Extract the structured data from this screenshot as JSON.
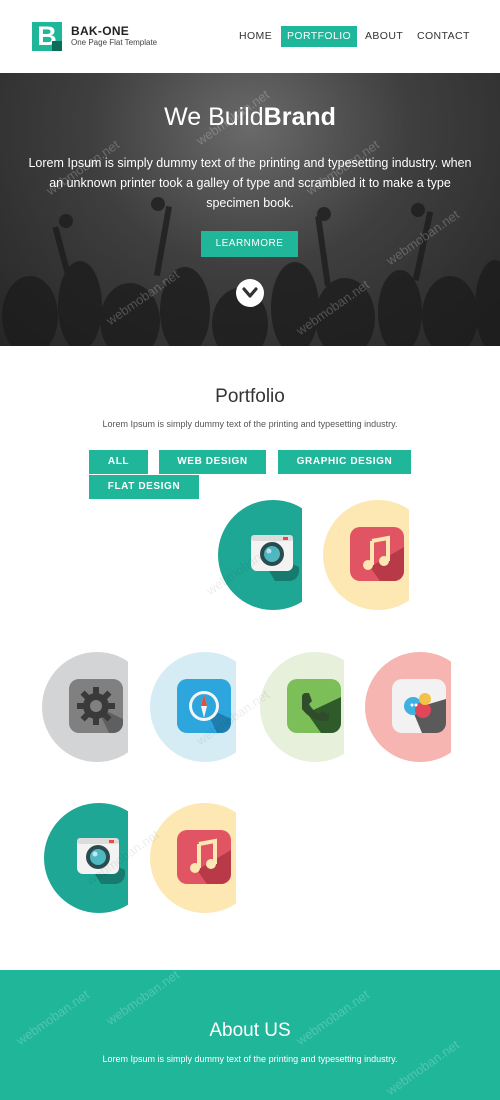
{
  "brand": {
    "name": "BAK-ONE",
    "tagline": "One Page Flat Template",
    "logo_letter": "B",
    "accent": "#1fb69a"
  },
  "nav": {
    "items": [
      "HOME",
      "PORTFOLIO",
      "ABOUT",
      "CONTACT"
    ],
    "active": "PORTFOLIO"
  },
  "hero": {
    "title_light": "We Build",
    "title_bold": "Brand",
    "text": "Lorem Ipsum is simply dummy text of the printing and typesetting industry. when an unknown printer took a galley of type and scrambled it to make a type specimen book.",
    "button": "LEARNMORE",
    "scroll_icon": "chevron-down-icon"
  },
  "portfolio": {
    "title": "Portfolio",
    "subtitle": "Lorem Ipsum is simply dummy text of the printing and typesetting industry.",
    "filters": [
      "ALL",
      "WEB DESIGN",
      "GRAPHIC DESIGN",
      "FLAT DESIGN"
    ],
    "items": [
      {
        "icon": "camera-icon",
        "bg": "#1fa796"
      },
      {
        "icon": "music-icon",
        "bg": "#fde8b3"
      },
      {
        "icon": "gear-icon",
        "bg": "#d3d4d5"
      },
      {
        "icon": "compass-icon",
        "bg": "#d6ecf4"
      },
      {
        "icon": "phone-icon",
        "bg": "#e6f0da"
      },
      {
        "icon": "chat-icon",
        "bg": "#f6b5b0"
      },
      {
        "icon": "camera-icon",
        "bg": "#1fa796"
      },
      {
        "icon": "music-icon",
        "bg": "#fde8b3"
      }
    ]
  },
  "about": {
    "title": "About US",
    "subtitle": "Lorem Ipsum is simply dummy text of the printing and typesetting industry."
  },
  "watermark": "webmoban.net"
}
